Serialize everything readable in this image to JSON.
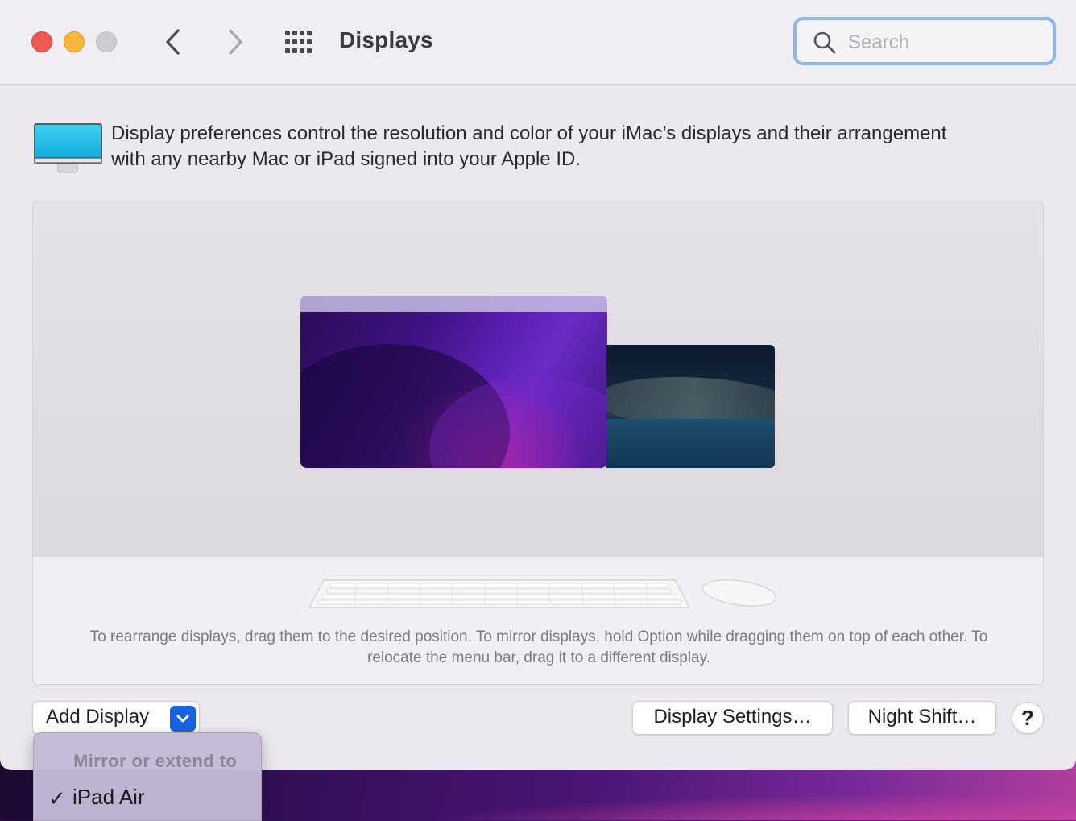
{
  "window": {
    "title": "Displays"
  },
  "search": {
    "placeholder": "Search",
    "value": ""
  },
  "intro": {
    "text": "Display preferences control the resolution and color of your iMac’s displays and their arrangement with any nearby Mac or iPad signed into your Apple ID."
  },
  "arrangement": {
    "hint": "To rearrange displays, drag them to the desired position. To mirror displays, hold Option while dragging them on top of each other. To relocate the menu bar, drag it to a different display."
  },
  "buttons": {
    "add_display": "Add Display",
    "display_settings": "Display Settings…",
    "night_shift": "Night Shift…",
    "help": "?"
  },
  "menu": {
    "header": "Mirror or extend to",
    "items": [
      {
        "label": "iPad Air",
        "checked": true,
        "check": "✓"
      }
    ]
  },
  "colors": {
    "accent": "#1a63e0",
    "close": "#ee5a52",
    "minimize": "#f5b73b",
    "zoom_disabled": "#cfcdd1"
  },
  "icons": {
    "back": "chevron-left-icon",
    "forward": "chevron-right-icon",
    "show_all": "grid-icon",
    "search": "magnifier-icon",
    "display": "imac-display-icon",
    "dropdown": "chevron-down-icon"
  }
}
